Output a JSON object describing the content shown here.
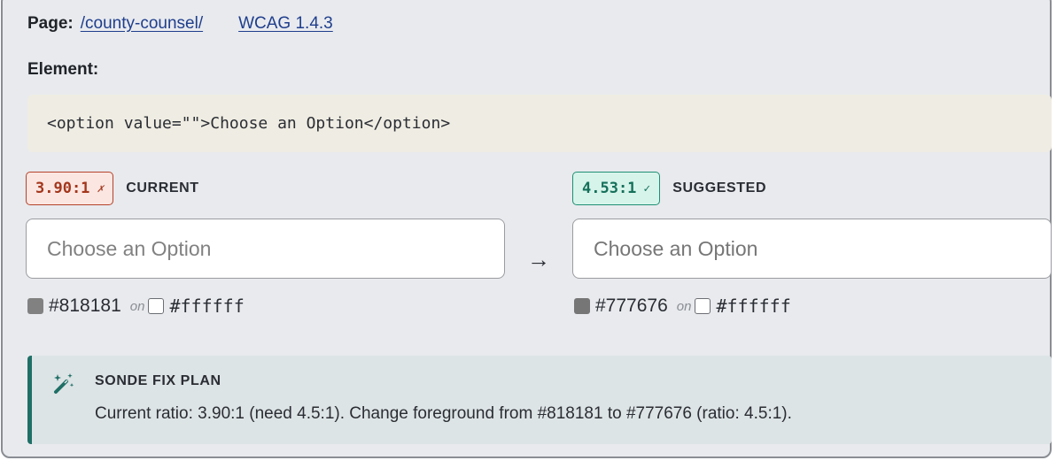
{
  "page": {
    "label": "Page:",
    "path_link": "/county-counsel/",
    "criterion_link": "WCAG 1.4.3"
  },
  "element": {
    "label": "Element:",
    "code": "<option value=\"\">Choose an Option</option>"
  },
  "current": {
    "ratio": "3.90:1",
    "mark": "✗",
    "caption": "CURRENT",
    "preview_text": "Choose an Option",
    "fg_hex": "#818181",
    "on_word": "on",
    "bg_hex": "#ffffff",
    "fg_color": "#818181",
    "bg_color": "#ffffff"
  },
  "suggested": {
    "ratio": "4.53:1",
    "mark": "✓",
    "caption": "SUGGESTED",
    "preview_text": "Choose an Option",
    "fg_hex": "#777676",
    "on_word": "on",
    "bg_hex": "#ffffff",
    "fg_color": "#777676",
    "bg_color": "#ffffff"
  },
  "arrow_glyph": "→",
  "fix_plan": {
    "icon": "magic-wand-icon",
    "title": "SONDE FIX PLAN",
    "text": "Current ratio: 3.90:1 (need 4.5:1). Change foreground from #818181 to #777676 (ratio: 4.5:1)."
  },
  "colors": {
    "card_bg": "#e8eaee",
    "code_bg": "#efece3",
    "fail_red": "#a3361c",
    "pass_green": "#15705a",
    "fix_accent": "#1f6f66"
  }
}
